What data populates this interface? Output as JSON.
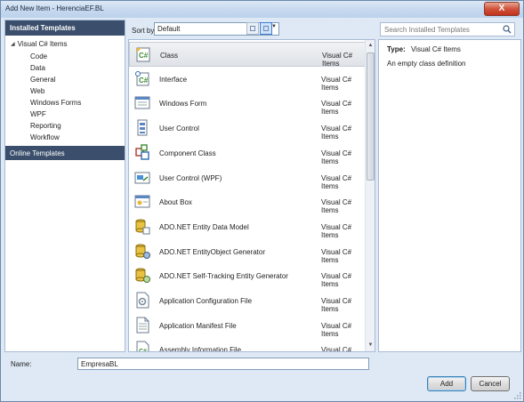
{
  "window": {
    "title": "Add New Item - HerenciaEF.BL",
    "close_label": "X"
  },
  "left_pane": {
    "header": "Installed Templates",
    "root": "Visual C# Items",
    "items": [
      "Code",
      "Data",
      "General",
      "Web",
      "Windows Forms",
      "WPF",
      "Reporting",
      "Workflow"
    ],
    "online": "Online Templates"
  },
  "toolbar": {
    "sort_label": "Sort by:",
    "sort_value": "Default"
  },
  "search": {
    "placeholder": "Search Installed Templates"
  },
  "templates": [
    {
      "name": "Class",
      "category": "Visual C# Items",
      "icon": "class-icon"
    },
    {
      "name": "Interface",
      "category": "Visual C# Items",
      "icon": "interface-icon"
    },
    {
      "name": "Windows Form",
      "category": "Visual C# Items",
      "icon": "windows-form-icon"
    },
    {
      "name": "User Control",
      "category": "Visual C# Items",
      "icon": "user-control-icon"
    },
    {
      "name": "Component Class",
      "category": "Visual C# Items",
      "icon": "component-class-icon"
    },
    {
      "name": "User Control (WPF)",
      "category": "Visual C# Items",
      "icon": "wpf-user-control-icon"
    },
    {
      "name": "About Box",
      "category": "Visual C# Items",
      "icon": "about-box-icon"
    },
    {
      "name": "ADO.NET Entity Data Model",
      "category": "Visual C# Items",
      "icon": "entity-data-model-icon"
    },
    {
      "name": "ADO.NET EntityObject Generator",
      "category": "Visual C# Items",
      "icon": "entityobject-generator-icon"
    },
    {
      "name": "ADO.NET Self-Tracking Entity Generator",
      "category": "Visual C# Items",
      "icon": "self-tracking-generator-icon"
    },
    {
      "name": "Application Configuration File",
      "category": "Visual C# Items",
      "icon": "config-file-icon"
    },
    {
      "name": "Application Manifest File",
      "category": "Visual C# Items",
      "icon": "manifest-file-icon"
    },
    {
      "name": "Assembly Information File",
      "category": "Visual C# Items",
      "icon": "assembly-info-icon"
    }
  ],
  "description": {
    "type_label": "Type:",
    "type_value": "Visual C# Items",
    "text": "An empty class definition"
  },
  "name_field": {
    "label": "Name:",
    "value": "EmpresaBL"
  },
  "buttons": {
    "add": "Add",
    "cancel": "Cancel"
  },
  "colors": {
    "header_bg": "#3b4f6c",
    "dialog_bg": "#dfe9f5",
    "csharp_green": "#3c8d2f"
  }
}
